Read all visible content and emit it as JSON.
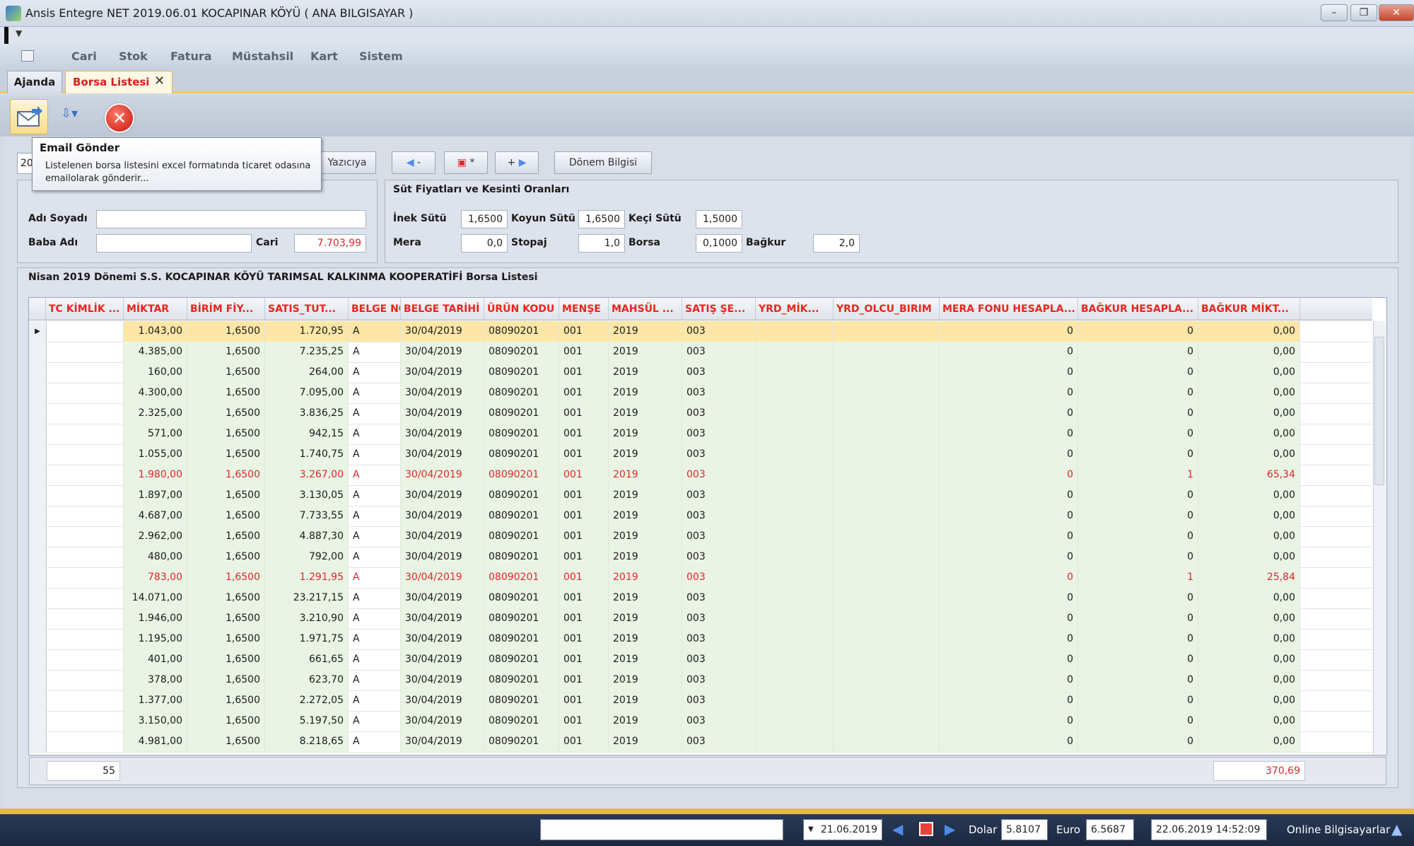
{
  "window": {
    "title": "Ansis Entegre NET 2019.06.01 KOCAPINAR KÖYÜ ( ANA BILGISAYAR )"
  },
  "menu": {
    "items": [
      "Cari",
      "Stok",
      "Fatura",
      "Müstahsil",
      "Kart",
      "Sistem"
    ]
  },
  "tabs": [
    {
      "label": "Ajanda"
    },
    {
      "label": "Borsa Listesi"
    }
  ],
  "toolbar": {
    "email_icon": "email-send-icon",
    "dropdown_icon": "dropdown-arrow-icon",
    "cancel_icon": "cancel-icon"
  },
  "tooltip": {
    "title": "Email Gönder",
    "body": "Listelenen borsa listesini excel formatında ticaret odasına emailolarak gönderir..."
  },
  "buttons": {
    "year_prefix": "20",
    "print": "Yazıcıya",
    "donem": "Dönem Bilgisi"
  },
  "person": {
    "name_label": "Adı Soyadı",
    "name_value": "",
    "father_label": "Baba Adı",
    "father_value": "",
    "cari_label": "Cari",
    "cari_value": "7.703,99"
  },
  "prices": {
    "title": "Süt Fiyatları ve Kesinti Oranları",
    "inek_label": "İnek Sütü",
    "inek": "1,6500",
    "koyun_label": "Koyun Sütü",
    "koyun": "1,6500",
    "keci_label": "Keçi Sütü",
    "keci": "1,5000",
    "mera_label": "Mera",
    "mera": "0,0",
    "stopaj_label": "Stopaj",
    "stopaj": "1,0",
    "borsa_label": "Borsa",
    "borsa": "0,1000",
    "bagkur_label": "Bağkur",
    "bagkur": "2,0"
  },
  "grid": {
    "title": "Nisan 2019 Dönemi S.S. KOCAPINAR KÖYÜ TARIMSAL KALKINMA KOOPERATİFİ  Borsa Listesi",
    "columns": [
      "TC KİMLİK ...",
      "MİKTAR",
      "BİRİM FİY...",
      "SATIS_TUT...",
      "BELGE NO",
      "BELGE TARİHİ",
      "ÜRÜN KODU",
      "MENŞE",
      "MAHSÜL ...",
      "SATIŞ ŞE...",
      "YRD_MİK...",
      "YRD_OLCU_BIRIM",
      "MERA FONU HESAPLA...",
      "BAĞKUR HESAPLA...",
      "BAĞKUR MİKT..."
    ],
    "rows": [
      {
        "miktar": "1.043,00",
        "birim": "1,6500",
        "satis": "1.720,95",
        "belge": "A",
        "tarih": "30/04/2019",
        "urun": "08090201",
        "mense": "001",
        "mahsul": "2019",
        "satis_se": "003",
        "mera": "0",
        "bagkur_h": "0",
        "bagkur_m": "0,00",
        "selected": true
      },
      {
        "miktar": "4.385,00",
        "birim": "1,6500",
        "satis": "7.235,25",
        "belge": "A",
        "tarih": "30/04/2019",
        "urun": "08090201",
        "mense": "001",
        "mahsul": "2019",
        "satis_se": "003",
        "mera": "0",
        "bagkur_h": "0",
        "bagkur_m": "0,00"
      },
      {
        "miktar": "160,00",
        "birim": "1,6500",
        "satis": "264,00",
        "belge": "A",
        "tarih": "30/04/2019",
        "urun": "08090201",
        "mense": "001",
        "mahsul": "2019",
        "satis_se": "003",
        "mera": "0",
        "bagkur_h": "0",
        "bagkur_m": "0,00"
      },
      {
        "miktar": "4.300,00",
        "birim": "1,6500",
        "satis": "7.095,00",
        "belge": "A",
        "tarih": "30/04/2019",
        "urun": "08090201",
        "mense": "001",
        "mahsul": "2019",
        "satis_se": "003",
        "mera": "0",
        "bagkur_h": "0",
        "bagkur_m": "0,00"
      },
      {
        "miktar": "2.325,00",
        "birim": "1,6500",
        "satis": "3.836,25",
        "belge": "A",
        "tarih": "30/04/2019",
        "urun": "08090201",
        "mense": "001",
        "mahsul": "2019",
        "satis_se": "003",
        "mera": "0",
        "bagkur_h": "0",
        "bagkur_m": "0,00"
      },
      {
        "miktar": "571,00",
        "birim": "1,6500",
        "satis": "942,15",
        "belge": "A",
        "tarih": "30/04/2019",
        "urun": "08090201",
        "mense": "001",
        "mahsul": "2019",
        "satis_se": "003",
        "mera": "0",
        "bagkur_h": "0",
        "bagkur_m": "0,00"
      },
      {
        "miktar": "1.055,00",
        "birim": "1,6500",
        "satis": "1.740,75",
        "belge": "A",
        "tarih": "30/04/2019",
        "urun": "08090201",
        "mense": "001",
        "mahsul": "2019",
        "satis_se": "003",
        "mera": "0",
        "bagkur_h": "0",
        "bagkur_m": "0,00"
      },
      {
        "miktar": "1.980,00",
        "birim": "1,6500",
        "satis": "3.267,00",
        "belge": "A",
        "tarih": "30/04/2019",
        "urun": "08090201",
        "mense": "001",
        "mahsul": "2019",
        "satis_se": "003",
        "mera": "0",
        "bagkur_h": "1",
        "bagkur_m": "65,34",
        "highlight": true
      },
      {
        "miktar": "1.897,00",
        "birim": "1,6500",
        "satis": "3.130,05",
        "belge": "A",
        "tarih": "30/04/2019",
        "urun": "08090201",
        "mense": "001",
        "mahsul": "2019",
        "satis_se": "003",
        "mera": "0",
        "bagkur_h": "0",
        "bagkur_m": "0,00"
      },
      {
        "miktar": "4.687,00",
        "birim": "1,6500",
        "satis": "7.733,55",
        "belge": "A",
        "tarih": "30/04/2019",
        "urun": "08090201",
        "mense": "001",
        "mahsul": "2019",
        "satis_se": "003",
        "mera": "0",
        "bagkur_h": "0",
        "bagkur_m": "0,00"
      },
      {
        "miktar": "2.962,00",
        "birim": "1,6500",
        "satis": "4.887,30",
        "belge": "A",
        "tarih": "30/04/2019",
        "urun": "08090201",
        "mense": "001",
        "mahsul": "2019",
        "satis_se": "003",
        "mera": "0",
        "bagkur_h": "0",
        "bagkur_m": "0,00"
      },
      {
        "miktar": "480,00",
        "birim": "1,6500",
        "satis": "792,00",
        "belge": "A",
        "tarih": "30/04/2019",
        "urun": "08090201",
        "mense": "001",
        "mahsul": "2019",
        "satis_se": "003",
        "mera": "0",
        "bagkur_h": "0",
        "bagkur_m": "0,00"
      },
      {
        "miktar": "783,00",
        "birim": "1,6500",
        "satis": "1.291,95",
        "belge": "A",
        "tarih": "30/04/2019",
        "urun": "08090201",
        "mense": "001",
        "mahsul": "2019",
        "satis_se": "003",
        "mera": "0",
        "bagkur_h": "1",
        "bagkur_m": "25,84",
        "highlight": true
      },
      {
        "miktar": "14.071,00",
        "birim": "1,6500",
        "satis": "23.217,15",
        "belge": "A",
        "tarih": "30/04/2019",
        "urun": "08090201",
        "mense": "001",
        "mahsul": "2019",
        "satis_se": "003",
        "mera": "0",
        "bagkur_h": "0",
        "bagkur_m": "0,00"
      },
      {
        "miktar": "1.946,00",
        "birim": "1,6500",
        "satis": "3.210,90",
        "belge": "A",
        "tarih": "30/04/2019",
        "urun": "08090201",
        "mense": "001",
        "mahsul": "2019",
        "satis_se": "003",
        "mera": "0",
        "bagkur_h": "0",
        "bagkur_m": "0,00"
      },
      {
        "miktar": "1.195,00",
        "birim": "1,6500",
        "satis": "1.971,75",
        "belge": "A",
        "tarih": "30/04/2019",
        "urun": "08090201",
        "mense": "001",
        "mahsul": "2019",
        "satis_se": "003",
        "mera": "0",
        "bagkur_h": "0",
        "bagkur_m": "0,00"
      },
      {
        "miktar": "401,00",
        "birim": "1,6500",
        "satis": "661,65",
        "belge": "A",
        "tarih": "30/04/2019",
        "urun": "08090201",
        "mense": "001",
        "mahsul": "2019",
        "satis_se": "003",
        "mera": "0",
        "bagkur_h": "0",
        "bagkur_m": "0,00"
      },
      {
        "miktar": "378,00",
        "birim": "1,6500",
        "satis": "623,70",
        "belge": "A",
        "tarih": "30/04/2019",
        "urun": "08090201",
        "mense": "001",
        "mahsul": "2019",
        "satis_se": "003",
        "mera": "0",
        "bagkur_h": "0",
        "bagkur_m": "0,00"
      },
      {
        "miktar": "1.377,00",
        "birim": "1,6500",
        "satis": "2.272,05",
        "belge": "A",
        "tarih": "30/04/2019",
        "urun": "08090201",
        "mense": "001",
        "mahsul": "2019",
        "satis_se": "003",
        "mera": "0",
        "bagkur_h": "0",
        "bagkur_m": "0,00"
      },
      {
        "miktar": "3.150,00",
        "birim": "1,6500",
        "satis": "5.197,50",
        "belge": "A",
        "tarih": "30/04/2019",
        "urun": "08090201",
        "mense": "001",
        "mahsul": "2019",
        "satis_se": "003",
        "mera": "0",
        "bagkur_h": "0",
        "bagkur_m": "0,00"
      },
      {
        "miktar": "4.981,00",
        "birim": "1,6500",
        "satis": "8.218,65",
        "belge": "A",
        "tarih": "30/04/2019",
        "urun": "08090201",
        "mense": "001",
        "mahsul": "2019",
        "satis_se": "003",
        "mera": "0",
        "bagkur_h": "0",
        "bagkur_m": "0,00"
      }
    ],
    "footer_count": "55",
    "footer_total": "370,69"
  },
  "status": {
    "date": "21.06.2019",
    "dolar_label": "Dolar",
    "dolar": "5.8107",
    "euro_label": "Euro",
    "euro": "6.5687",
    "datetime": "22.06.2019  14:52:09",
    "online": "Online Bilgisayarlar"
  },
  "colors": {
    "accent": "#e8261f",
    "row_green": "#e9f4e4",
    "selected": "#fde6a6",
    "highlight_text": "#e0262a"
  }
}
